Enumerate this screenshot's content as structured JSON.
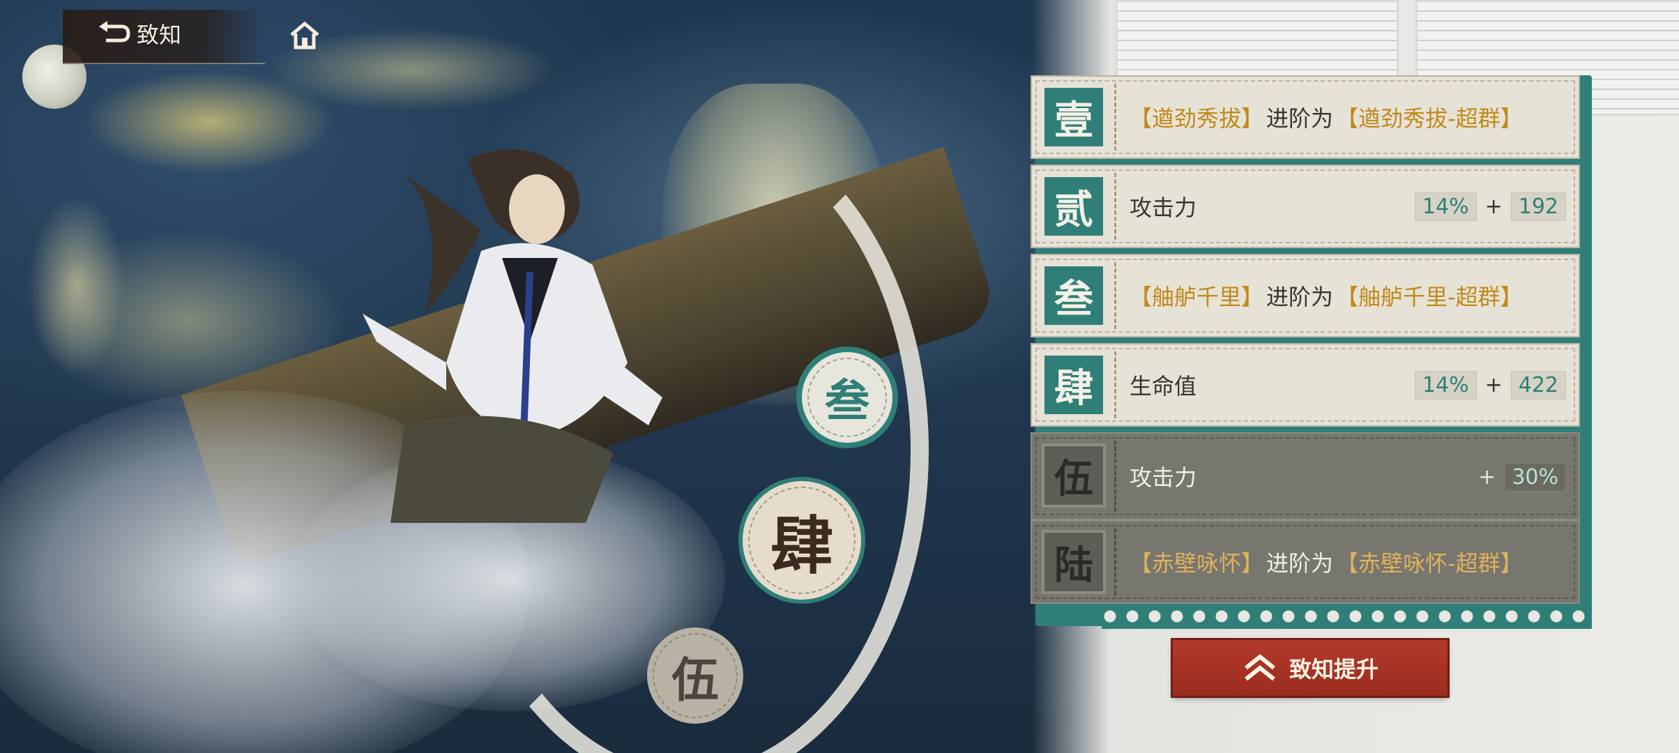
{
  "nav": {
    "back_label": "致知",
    "back_icon": "return-arrow-icon",
    "home_icon": "home-icon"
  },
  "medallions": [
    {
      "label": "叁",
      "state": "active"
    },
    {
      "label": "肆",
      "state": "current"
    },
    {
      "label": "伍",
      "state": "locked"
    }
  ],
  "rows": [
    {
      "badge": "壹",
      "state": "unlocked",
      "type": "advance",
      "bracket_open": "【",
      "bracket_close": "】",
      "skill": "遒劲秀拔",
      "mid": "进阶为",
      "result": "遒劲秀拔-超群"
    },
    {
      "badge": "贰",
      "state": "unlocked",
      "type": "stat",
      "label": "攻击力",
      "percent": "14%",
      "plus": "+",
      "flat": "192"
    },
    {
      "badge": "叁",
      "state": "unlocked",
      "type": "advance",
      "bracket_open": "【",
      "bracket_close": "】",
      "skill": "舳舻千里",
      "mid": "进阶为",
      "result": "舳舻千里-超群"
    },
    {
      "badge": "肆",
      "state": "unlocked",
      "type": "stat",
      "label": "生命值",
      "percent": "14%",
      "plus": "+",
      "flat": "422"
    },
    {
      "badge": "伍",
      "state": "locked",
      "type": "stat_single",
      "label": "攻击力",
      "plus": "+",
      "percent": "30%"
    },
    {
      "badge": "陆",
      "state": "locked",
      "type": "advance",
      "bracket_open": "【",
      "bracket_close": "】",
      "skill": "赤壁咏怀",
      "mid": "进阶为",
      "result": "赤壁咏怀-超群"
    }
  ],
  "action": {
    "label": "致知提升",
    "icon": "double-chevron-up-icon"
  },
  "colors": {
    "teal": "#2f7f78",
    "gold": "#c08a1a",
    "red_button": "#a8321f",
    "parchment": "#e6e2d6",
    "locked": "#77766f"
  }
}
